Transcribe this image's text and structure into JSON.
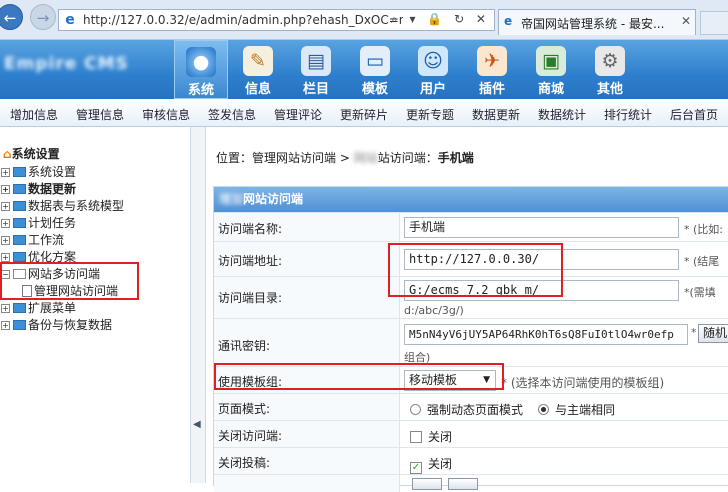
{
  "browser": {
    "url": "http://127.0.0.32/e/admin/admin.php?ehash_DxOC=mZ",
    "url_tools": "⌕ ▾ 🔒 ↻ ✕",
    "tab_title": "帝国网站管理系统 - 最安...",
    "tab_close": "✕"
  },
  "header": {
    "logo_text": "Empire CMS",
    "modules": [
      {
        "icon": "●",
        "label": "系统"
      },
      {
        "icon": "✎",
        "label": "信息"
      },
      {
        "icon": "▤",
        "label": "栏目"
      },
      {
        "icon": "▭",
        "label": "模板"
      },
      {
        "icon": "☺",
        "label": "用户"
      },
      {
        "icon": "✈",
        "label": "插件"
      },
      {
        "icon": "▣",
        "label": "商城"
      },
      {
        "icon": "⚙",
        "label": "其他"
      }
    ]
  },
  "menu": [
    "增加信息",
    "管理信息",
    "审核信息",
    "签发信息",
    "管理评论",
    "更新碎片",
    "更新专题",
    "数据更新",
    "数据统计",
    "排行统计",
    "后台首页"
  ],
  "sidebar": {
    "title": "系统设置",
    "items": [
      "系统设置",
      "数据更新",
      "数据表与系统模型",
      "计划任务",
      "工作流",
      "优化方案",
      "网站多访问端",
      "管理网站访问端",
      "扩展菜单",
      "备份与恢复数据"
    ]
  },
  "breadcrumb": {
    "prefix": "位置：",
    "link1": "管理网站访问端",
    "sep": " > ",
    "blurred": "网站",
    "link2": "站访问端：",
    "current": "手机端"
  },
  "form": {
    "title_blurred": "增加",
    "title": "网站访问端",
    "name_label": "访问端名称:",
    "name_value": "手机端",
    "name_hint": "* (比如:",
    "url_label": "访问端地址:",
    "url_value": "http://127.0.0.30/",
    "url_hint": "* (结尾",
    "dir_label": "访问端目录:",
    "dir_value": "G:/ecms_7.2_gbk_m/",
    "dir_hint": "*(需填",
    "dir_hint2": "d:/abc/3g/)",
    "key_label": "通讯密钥:",
    "key_value": "M5nN4yV6jUY5AP64RhK0hT6sQ8FuI0tlO4wr0efp",
    "key_button": "随机",
    "key_hint2": "组合)",
    "tpl_label": "使用模板组:",
    "tpl_value": "移动模板",
    "tpl_hint": "* (选择本访问端使用的模板组)",
    "mode_label": "页面模式:",
    "mode_opt1": "强制动态页面模式",
    "mode_opt2": "与主端相同",
    "close_label": "关闭访问端:",
    "close_opt": "关闭",
    "close_post_label": "关闭投稿:",
    "close_post_opt": "关闭"
  }
}
